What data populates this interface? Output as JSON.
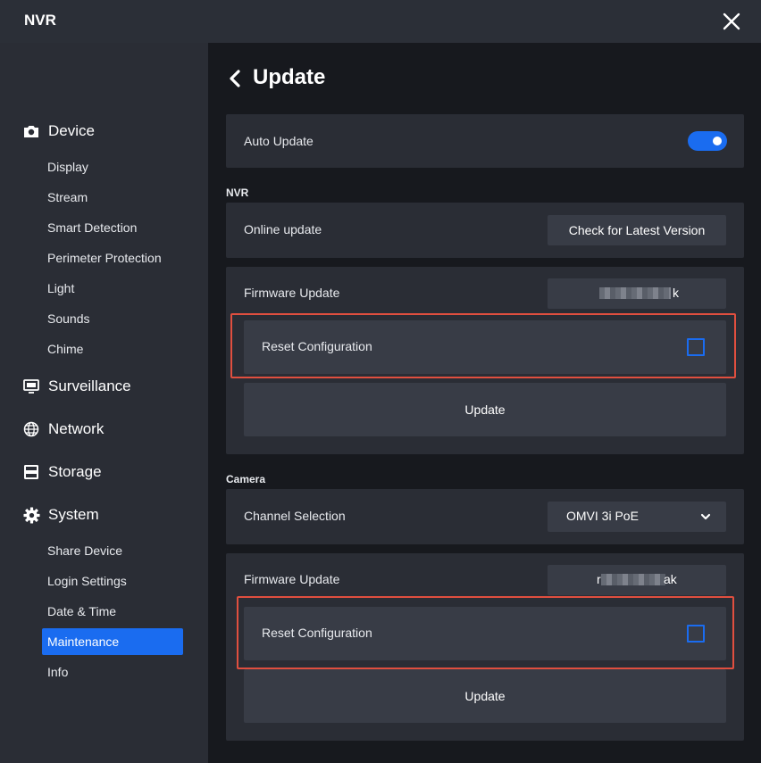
{
  "window": {
    "title": "NVR"
  },
  "sidebar": {
    "groups": [
      {
        "label": "Device",
        "icon": "camera-icon"
      },
      {
        "label": "Surveillance",
        "icon": "monitor-icon"
      },
      {
        "label": "Network",
        "icon": "globe-icon"
      },
      {
        "label": "Storage",
        "icon": "storage-icon"
      },
      {
        "label": "System",
        "icon": "gear-icon"
      }
    ],
    "device_items": [
      "Display",
      "Stream",
      "Smart Detection",
      "Perimeter Protection",
      "Light",
      "Sounds",
      "Chime"
    ],
    "system_items": [
      "Share Device",
      "Login Settings",
      "Date & Time",
      "Maintenance",
      "Info"
    ],
    "active_item": "Maintenance"
  },
  "page": {
    "title": "Update",
    "auto_update": {
      "label": "Auto Update",
      "enabled": true
    },
    "nvr": {
      "section_label": "NVR",
      "online_update_label": "Online update",
      "check_button": "Check for Latest Version",
      "firmware_label": "Firmware Update",
      "firmware_file_tail": "k",
      "reset_label": "Reset Configuration",
      "reset_checked": false,
      "update_button": "Update"
    },
    "camera": {
      "section_label": "Camera",
      "channel_label": "Channel Selection",
      "channel_value": "OMVI 3i PoE",
      "firmware_label": "Firmware Update",
      "firmware_file_head": "r",
      "firmware_file_tail": "ak",
      "reset_label": "Reset Configuration",
      "reset_checked": false,
      "update_button": "Update"
    }
  },
  "colors": {
    "accent": "#1a6cf0",
    "highlight": "#e04f3f",
    "sidebar_bg": "#2a2d35",
    "main_bg": "#17191e"
  }
}
